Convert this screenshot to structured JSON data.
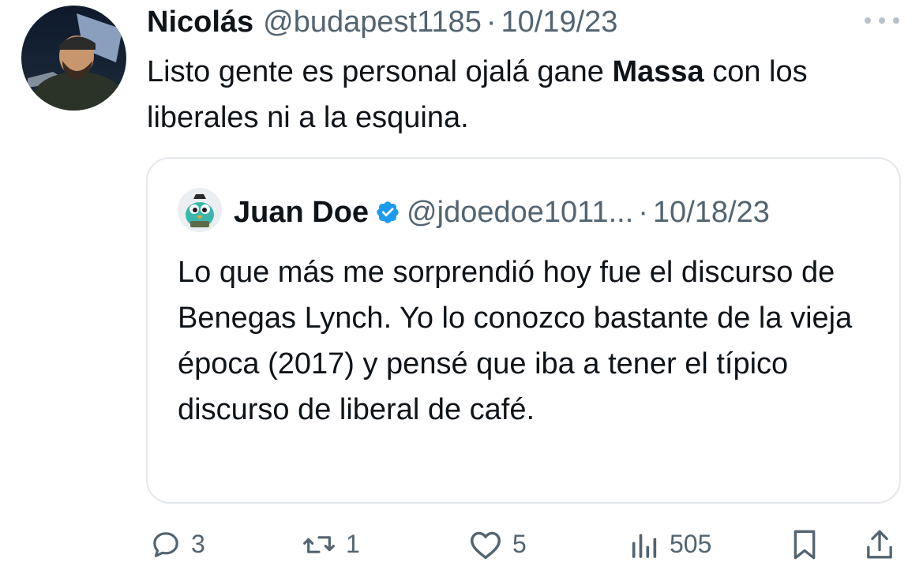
{
  "tweet": {
    "author_name": "Nicolás",
    "handle": "@budapest1185",
    "separator": "·",
    "date": "10/19/23",
    "text_before": "Listo gente es personal ojalá gane ",
    "text_bold": "Massa",
    "text_after": " con los liberales ni a la esquina."
  },
  "quoted": {
    "author_name": "Juan Doe",
    "handle": "@jdoedoe1011...",
    "separator": "·",
    "date": "10/18/23",
    "text": "Lo que más me sorprendió hoy fue el discurso de Benegas Lynch. Yo lo conozco bastante de la vieja época (2017) y pensé que iba a tener el típico discurso de liberal de café."
  },
  "actions": {
    "replies": "3",
    "retweets": "1",
    "likes": "5",
    "views": "505"
  },
  "icons": {
    "reply": "reply-icon",
    "retweet": "retweet-icon",
    "like": "heart-icon",
    "views": "views-icon",
    "bookmark": "bookmark-icon",
    "share": "share-icon",
    "more": "more-icon",
    "verified": "verified-badge-icon"
  },
  "colors": {
    "text_primary": "#0f1419",
    "text_secondary": "#536471",
    "verified": "#1d9bf0",
    "border": "#e4e8eb"
  }
}
